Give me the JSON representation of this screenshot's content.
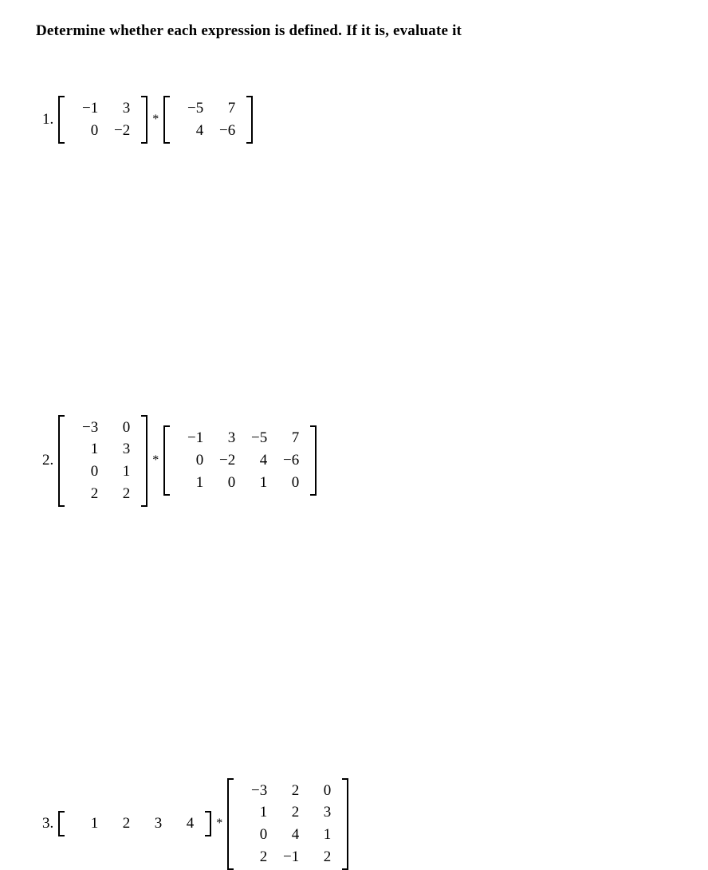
{
  "title": "Determine whether each expression is defined. If it is, evaluate it",
  "problems": [
    {
      "num": "1.",
      "left": {
        "rows": 2,
        "cols": 2,
        "cells": [
          "−1",
          "3",
          "0",
          "−2"
        ]
      },
      "op": "*",
      "right": {
        "rows": 2,
        "cols": 2,
        "cells": [
          "−5",
          "7",
          "4",
          "−6"
        ]
      }
    },
    {
      "num": "2.",
      "left": {
        "rows": 4,
        "cols": 2,
        "cells": [
          "−3",
          "0",
          "1",
          "3",
          "0",
          "1",
          "2",
          "2"
        ]
      },
      "op": "*",
      "right": {
        "rows": 3,
        "cols": 4,
        "cells": [
          "−1",
          "3",
          "−5",
          "7",
          "0",
          "−2",
          "4",
          "−6",
          "1",
          "0",
          "1",
          "0"
        ]
      }
    },
    {
      "num": "3.",
      "left": {
        "rows": 1,
        "cols": 4,
        "cells": [
          "1",
          "2",
          "3",
          "4"
        ]
      },
      "op": "*",
      "right": {
        "rows": 4,
        "cols": 3,
        "cells": [
          "−3",
          "2",
          "0",
          "1",
          "2",
          "3",
          "0",
          "4",
          "1",
          "2",
          "−1",
          "2"
        ]
      }
    }
  ]
}
